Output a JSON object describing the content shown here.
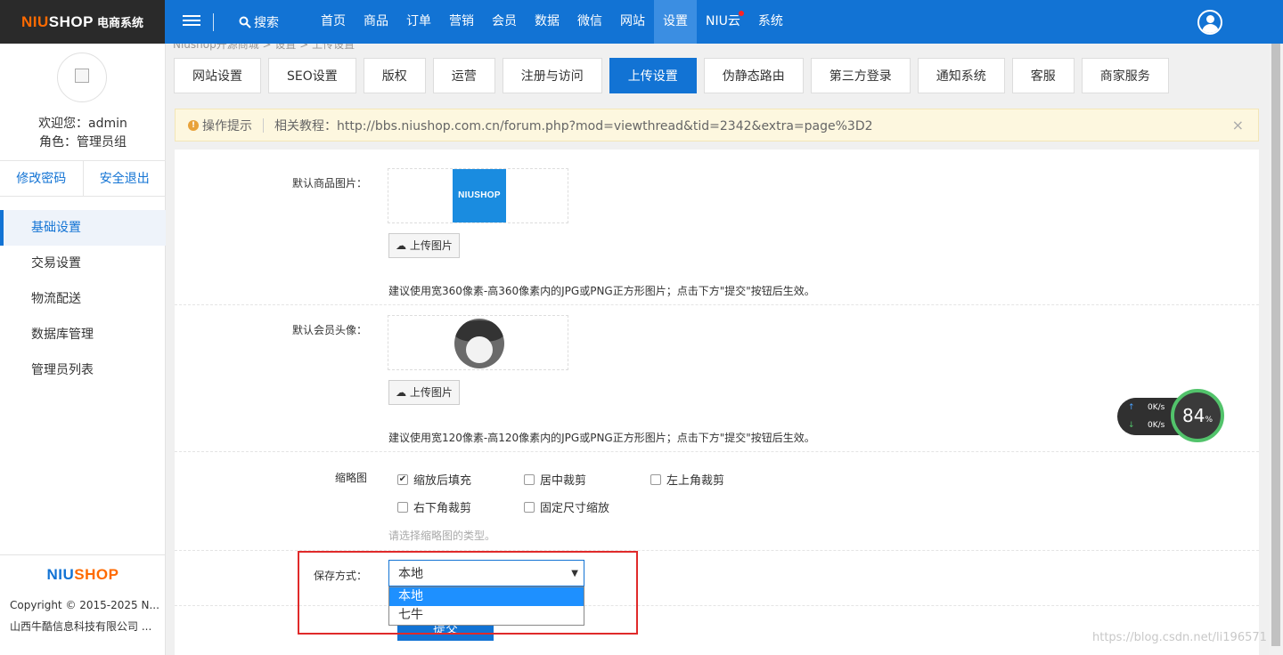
{
  "header": {
    "brand_main": "NIUSHOP",
    "brand_sub": "电商系统",
    "search_label": "搜索",
    "nav": [
      {
        "label": "首页"
      },
      {
        "label": "商品"
      },
      {
        "label": "订单"
      },
      {
        "label": "营销"
      },
      {
        "label": "会员"
      },
      {
        "label": "数据"
      },
      {
        "label": "微信"
      },
      {
        "label": "网站"
      },
      {
        "label": "设置",
        "active": true
      },
      {
        "label": "NIU云",
        "dot": true
      },
      {
        "label": "系统"
      }
    ]
  },
  "sidebar": {
    "welcome": "欢迎您：admin",
    "role": "角色：管理员组",
    "change_password": "修改密码",
    "logout": "安全退出",
    "items": [
      {
        "label": "基础设置",
        "active": true
      },
      {
        "label": "交易设置"
      },
      {
        "label": "物流配送"
      },
      {
        "label": "数据库管理"
      },
      {
        "label": "管理员列表"
      }
    ],
    "footer_logo": "NIUSHOP",
    "copyright": "Copyright © 2015-2025 N...",
    "company": "山西牛酷信息科技有限公司 ..."
  },
  "main": {
    "breadcrumb": "Niushop开源商城 > 设置 > 上传设置",
    "tabs": [
      {
        "label": "网站设置"
      },
      {
        "label": "SEO设置"
      },
      {
        "label": "版权"
      },
      {
        "label": "运营"
      },
      {
        "label": "注册与访问"
      },
      {
        "label": "上传设置",
        "active": true
      },
      {
        "label": "伪静态路由"
      },
      {
        "label": "第三方登录"
      },
      {
        "label": "通知系统"
      },
      {
        "label": "客服"
      },
      {
        "label": "商家服务"
      }
    ],
    "tip": {
      "label": "操作提示",
      "text": "相关教程：http://bbs.niushop.com.cn/forum.php?mod=viewthread&tid=2342&extra=page%3D2",
      "close": "×"
    },
    "form": {
      "goods_image_label": "默认商品图片：",
      "goods_image_logo": "NIUSHOP",
      "upload_label": "上传图片",
      "goods_image_hint": "建议使用宽360像素-高360像素内的JPG或PNG正方形图片；点击下方\"提交\"按钮后生效。",
      "member_avatar_label": "默认会员头像：",
      "member_avatar_hint": "建议使用宽120像素-高120像素内的JPG或PNG正方形图片；点击下方\"提交\"按钮后生效。",
      "thumb_label": "缩略图",
      "thumb_options": [
        {
          "label": "缩放后填充",
          "checked": true
        },
        {
          "label": "居中裁剪",
          "checked": false
        },
        {
          "label": "左上角裁剪",
          "checked": false
        },
        {
          "label": "右下角裁剪",
          "checked": false
        },
        {
          "label": "固定尺寸缩放",
          "checked": false
        }
      ],
      "thumb_hint": "请选择缩略图的类型。",
      "storage_label": "保存方式：",
      "storage_value": "本地",
      "storage_options": [
        {
          "label": "本地",
          "selected": true
        },
        {
          "label": "七牛",
          "selected": false
        }
      ],
      "submit_label": "提交"
    }
  },
  "speed_widget": {
    "up": "0",
    "down": "0",
    "unit": "K/s",
    "percent": "84",
    "percent_unit": "%"
  },
  "watermark": "https://blog.csdn.net/li196571",
  "colors": {
    "primary": "#1273d4",
    "highlight_box": "#e02a2a",
    "logo_accent": "#ff6a00"
  }
}
